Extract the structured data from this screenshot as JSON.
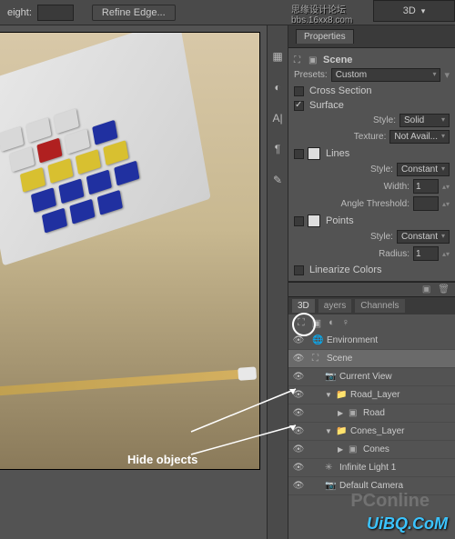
{
  "topbar": {
    "height_label": "eight:",
    "refine_label": "Refine Edge..."
  },
  "workspace": {
    "label": "3D"
  },
  "watermarks": {
    "top1": "思缘设计论坛",
    "top2": "bbs.16xx8.com",
    "bottom_pc": "PConline",
    "bottom": "UiBQ.CoM"
  },
  "properties": {
    "tab_label": "Properties",
    "scene_label": "Scene",
    "presets_label": "Presets:",
    "presets_value": "Custom",
    "cross_section": "Cross Section",
    "surface": "Surface",
    "style_label": "Style:",
    "surface_style": "Solid",
    "texture_label": "Texture:",
    "texture_value": "Not Avail...",
    "lines": "Lines",
    "lines_style": "Constant",
    "width_label": "Width:",
    "width_value": "1",
    "angle_label": "Angle Threshold:",
    "points": "Points",
    "points_style": "Constant",
    "radius_label": "Radius:",
    "radius_value": "1",
    "linearize": "Linearize Colors"
  },
  "panel3d": {
    "tab_3d": "3D",
    "tab_layers": "ayers",
    "tab_channels": "Channels",
    "items": [
      {
        "label": "Environment",
        "icon": "globe",
        "depth": 0
      },
      {
        "label": "Scene",
        "icon": "scene",
        "depth": 0,
        "selected": true
      },
      {
        "label": "Current View",
        "icon": "camera",
        "depth": 1
      },
      {
        "label": "Road_Layer",
        "icon": "folder",
        "depth": 1,
        "expanded": true
      },
      {
        "label": "Road",
        "icon": "mesh",
        "depth": 2
      },
      {
        "label": "Cones_Layer",
        "icon": "folder",
        "depth": 1,
        "expanded": true
      },
      {
        "label": "Cones",
        "icon": "mesh",
        "depth": 2
      },
      {
        "label": "Infinite Light 1",
        "icon": "light",
        "depth": 1
      },
      {
        "label": "Default Camera",
        "icon": "camera",
        "depth": 1
      }
    ]
  },
  "annotation": {
    "hide_objects": "Hide objects"
  }
}
